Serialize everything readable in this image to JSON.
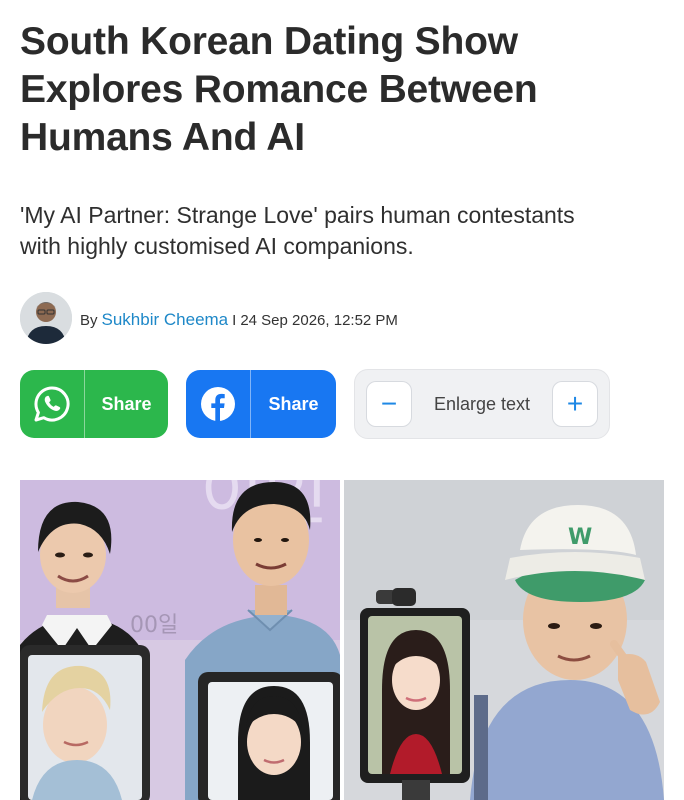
{
  "article": {
    "headline_lines": [
      "South Korean Dating Show",
      "Explores Romance Between",
      "Humans And AI"
    ],
    "subheadline_lines": [
      "'My AI Partner: Strange Love' pairs human contestants",
      "with highly customised AI companions."
    ]
  },
  "byline": {
    "prefix": "By",
    "author": "Sukhbir Cheema",
    "separator": "I",
    "date": "24 Sep 2026, 12:52 PM"
  },
  "actions": {
    "whatsapp": {
      "icon": "whatsapp-icon",
      "label": "Share",
      "color": "#2cb74c"
    },
    "facebook": {
      "icon": "facebook-icon",
      "label": "Share",
      "color": "#1877f2"
    },
    "enlarge": {
      "label": "Enlarge text",
      "decrease": "−",
      "increase": "+",
      "accent": "#1e88e5"
    }
  },
  "photo": {
    "sign_text": "00일",
    "cap_logo": "W"
  }
}
